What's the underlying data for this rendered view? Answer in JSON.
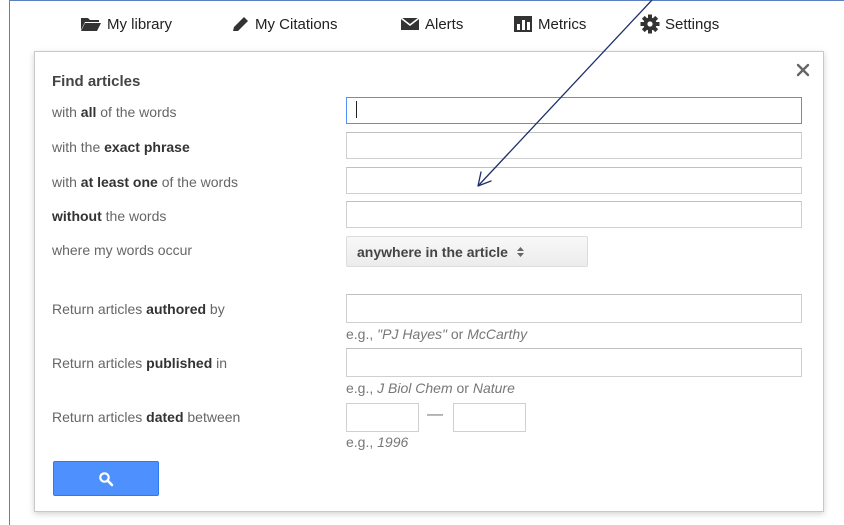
{
  "nav": {
    "items": [
      {
        "label": "My library",
        "icon": "folder-icon"
      },
      {
        "label": "My Citations",
        "icon": "pencil-icon"
      },
      {
        "label": "Alerts",
        "icon": "envelope-icon"
      },
      {
        "label": "Metrics",
        "icon": "bar-chart-icon"
      },
      {
        "label": "Settings",
        "icon": "gear-icon"
      }
    ]
  },
  "dialog": {
    "title": "Find articles",
    "rows": [
      {
        "pre": "with ",
        "bold": "all",
        "post": " of the words",
        "value": ""
      },
      {
        "pre": "with the ",
        "bold": "exact phrase",
        "post": "",
        "value": ""
      },
      {
        "pre": "with ",
        "bold": "at least one",
        "post": " of the words",
        "value": ""
      },
      {
        "pre": "",
        "bold": "without",
        "post": " the words",
        "value": ""
      }
    ],
    "occur": {
      "label": "where my words occur",
      "selected": "anywhere in the article"
    },
    "authored": {
      "pre": "Return articles ",
      "bold": "authored",
      "post": " by",
      "hint_pre": "e.g., ",
      "hint_i1": "\"PJ Hayes\"",
      "hint_mid": " or ",
      "hint_i2": "McCarthy"
    },
    "published": {
      "pre": "Return articles ",
      "bold": "published",
      "post": " in",
      "hint_pre": "e.g., ",
      "hint_i1": "J Biol Chem",
      "hint_mid": " or ",
      "hint_i2": "Nature"
    },
    "dated": {
      "pre": "Return articles ",
      "bold": "dated",
      "post": " between",
      "separator": "—",
      "hint_pre": "e.g., ",
      "hint_i1": "1996"
    }
  },
  "colors": {
    "accent": "#4d90fe",
    "annotation_arrow": "#1f2f6b"
  }
}
